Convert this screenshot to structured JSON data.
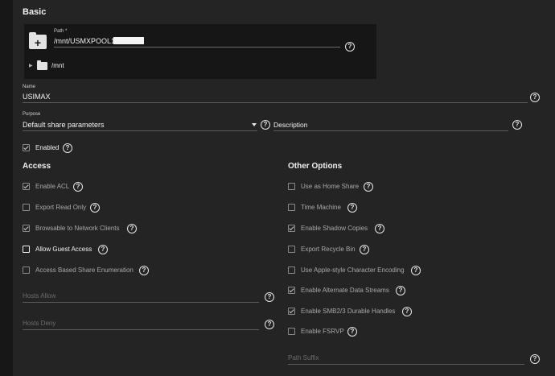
{
  "basic": {
    "title": "Basic",
    "path_label": "Path *",
    "path_value": "/mnt/USMXPOOL1/",
    "tree_root": "/mnt",
    "name_label": "Name",
    "name_value": "USIMAX",
    "purpose_label": "Purpose",
    "purpose_value": "Default share parameters",
    "description_placeholder": "Description",
    "enabled_label": "Enabled",
    "enabled_checked": true
  },
  "access": {
    "title": "Access",
    "options": [
      {
        "label": "Enable ACL",
        "checked": true
      },
      {
        "label": "Export Read Only",
        "checked": false
      },
      {
        "label": "Browsable to Network Clients",
        "checked": true
      },
      {
        "label": "Allow Guest Access",
        "checked": false
      },
      {
        "label": "Access Based Share Enumeration",
        "checked": false
      }
    ],
    "hosts_allow_placeholder": "Hosts Allow",
    "hosts_deny_placeholder": "Hosts Deny"
  },
  "other": {
    "title": "Other Options",
    "options": [
      {
        "label": "Use as Home Share",
        "checked": false
      },
      {
        "label": "Time Machine",
        "checked": false
      },
      {
        "label": "Enable Shadow Copies",
        "checked": true
      },
      {
        "label": "Export Recycle Bin",
        "checked": false
      },
      {
        "label": "Use Apple-style Character Encoding",
        "checked": false
      },
      {
        "label": "Enable Alternate Data Streams",
        "checked": true
      },
      {
        "label": "Enable SMB2/3 Durable Handles",
        "checked": true
      },
      {
        "label": "Enable FSRVP",
        "checked": false
      }
    ],
    "path_suffix_placeholder": "Path Suffix"
  },
  "help_glyph": "?",
  "colors": {
    "background": "#242424",
    "tree_background": "#161616",
    "text": "#f2f2f2",
    "muted": "#a8a8a8"
  }
}
